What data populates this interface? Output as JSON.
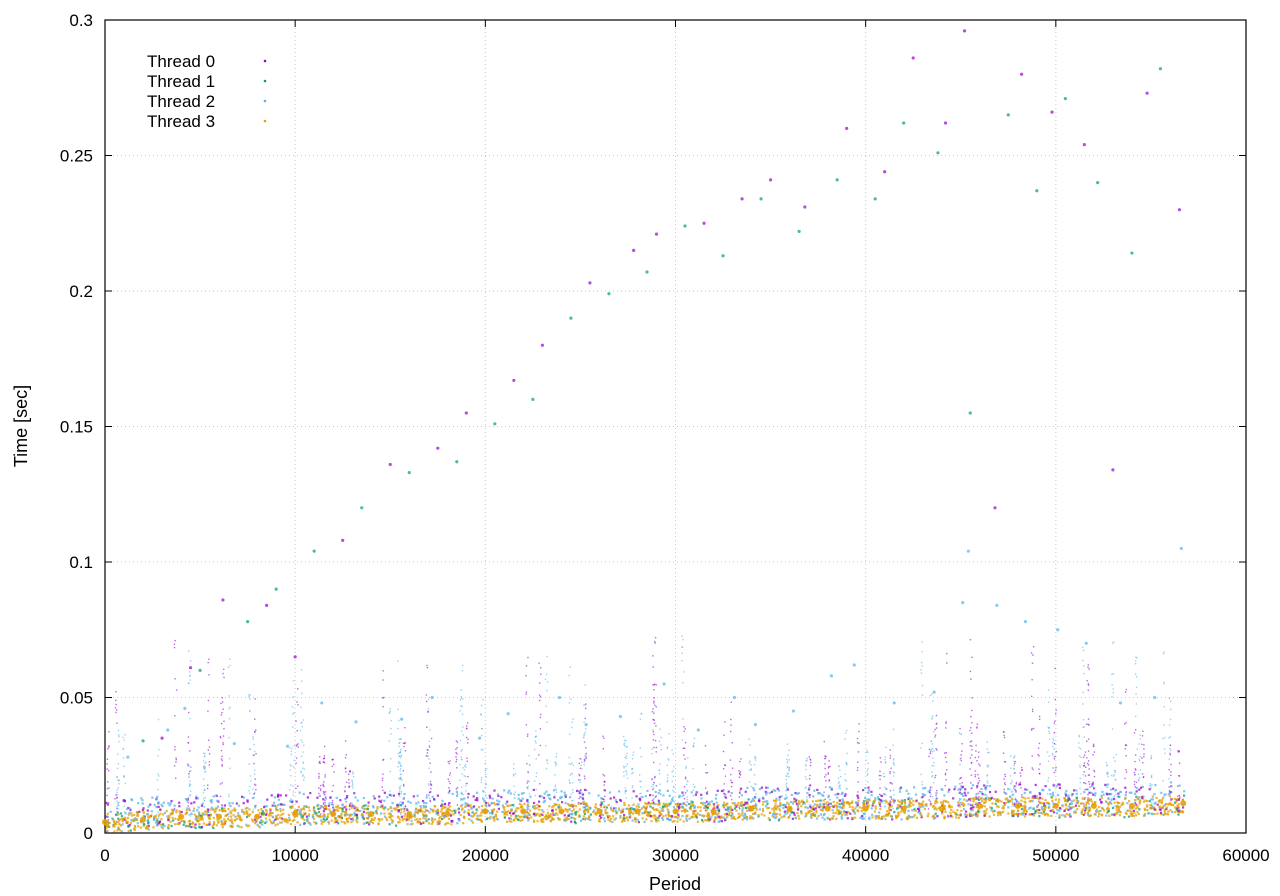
{
  "chart_data": {
    "type": "scatter",
    "xlabel": "Period",
    "ylabel": "Time [sec]",
    "xlim": [
      0,
      60000
    ],
    "ylim": [
      0,
      0.3
    ],
    "x_ticks": [
      "0",
      "10000",
      "20000",
      "30000",
      "40000",
      "50000",
      "60000"
    ],
    "y_ticks": [
      "0",
      "0.05",
      "0.1",
      "0.15",
      "0.2",
      "0.25",
      "0.3"
    ],
    "grid": true,
    "legend_position": "top-left",
    "series": [
      {
        "name": "Thread 0",
        "color": "#9400d3",
        "x": [
          1000,
          3000,
          4500,
          6200,
          8500,
          10000,
          12500,
          15000,
          17500,
          19000,
          21500,
          23000,
          25500,
          27800,
          29000,
          31500,
          33500,
          35000,
          36800,
          39000,
          41000,
          42500,
          44200,
          45200,
          46800,
          48200,
          49800,
          51500,
          53000,
          54800,
          56500
        ],
        "y": [
          0.012,
          0.035,
          0.061,
          0.086,
          0.084,
          0.065,
          0.108,
          0.136,
          0.142,
          0.155,
          0.167,
          0.18,
          0.203,
          0.215,
          0.221,
          0.225,
          0.234,
          0.241,
          0.231,
          0.26,
          0.244,
          0.286,
          0.262,
          0.296,
          0.12,
          0.28,
          0.266,
          0.254,
          0.134,
          0.273,
          0.23
        ]
      },
      {
        "name": "Thread 1",
        "color": "#009e73",
        "x": [
          2000,
          5000,
          7500,
          9000,
          11000,
          13500,
          16000,
          18500,
          20500,
          22500,
          24500,
          26500,
          28500,
          30500,
          32500,
          34500,
          36500,
          38500,
          40500,
          42000,
          43800,
          45500,
          47500,
          49000,
          50500,
          52200,
          54000,
          55500
        ],
        "y": [
          0.034,
          0.06,
          0.078,
          0.09,
          0.104,
          0.12,
          0.133,
          0.137,
          0.151,
          0.16,
          0.19,
          0.199,
          0.207,
          0.224,
          0.213,
          0.234,
          0.222,
          0.241,
          0.234,
          0.262,
          0.251,
          0.155,
          0.265,
          0.237,
          0.271,
          0.24,
          0.214,
          0.282
        ]
      },
      {
        "name": "Thread 2",
        "color": "#56b4e9",
        "x": [
          1200,
          3300,
          4200,
          6800,
          9600,
          11400,
          13200,
          15600,
          17200,
          19700,
          21200,
          23900,
          25300,
          27100,
          29400,
          31200,
          33100,
          34200,
          36200,
          38200,
          39400,
          41500,
          43600,
          45100,
          45400,
          46900,
          48400,
          50100,
          51600,
          53400,
          55200,
          56600
        ],
        "y": [
          0.028,
          0.038,
          0.046,
          0.033,
          0.032,
          0.048,
          0.041,
          0.042,
          0.05,
          0.035,
          0.044,
          0.05,
          0.04,
          0.043,
          0.055,
          0.038,
          0.05,
          0.04,
          0.045,
          0.058,
          0.062,
          0.048,
          0.052,
          0.085,
          0.104,
          0.084,
          0.078,
          0.075,
          0.07,
          0.048,
          0.05,
          0.105
        ]
      },
      {
        "name": "Thread 3",
        "color": "#e69f00",
        "x": [
          0,
          2000,
          4000,
          6000,
          8000,
          10000,
          12000,
          14000,
          16000,
          18000,
          20000,
          22000,
          24000,
          26000,
          28000,
          30000,
          32000,
          34000,
          36000,
          38000,
          40000,
          42000,
          44000,
          46000,
          48000,
          50000,
          52000,
          54000,
          56700
        ],
        "y": [
          0.004,
          0.005,
          0.006,
          0.006,
          0.006,
          0.007,
          0.007,
          0.007,
          0.007,
          0.007,
          0.008,
          0.008,
          0.008,
          0.008,
          0.008,
          0.008,
          0.008,
          0.009,
          0.009,
          0.009,
          0.009,
          0.009,
          0.009,
          0.01,
          0.01,
          0.01,
          0.01,
          0.01,
          0.011
        ]
      }
    ]
  }
}
